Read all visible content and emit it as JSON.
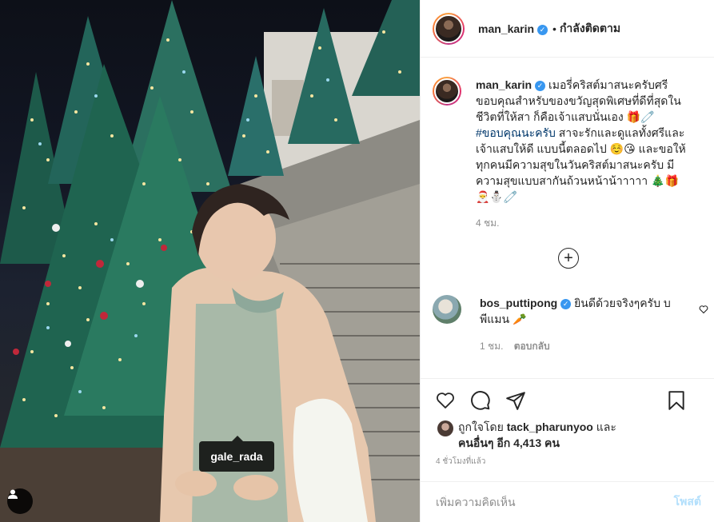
{
  "photo": {
    "tag_label": "gale_rada",
    "user_icon": "user-tags-icon"
  },
  "header": {
    "username": "man_karin",
    "separator": "•",
    "follow_label": "กำลังติดตาม"
  },
  "caption": {
    "username": "man_karin",
    "text_before_tag": "เมอรี่คริสต์มาสนะครับศรี ขอบคุณสำหรับของขวัญสุดพิเศษที่ดีที่สุดในชีวิตที่ให้สา ก็คือเจ้าแสบนั่นเอง 🎁🧷",
    "hashtag": "#ขอบคุณนะครับ",
    "text_after_tag": " สาจะรักและดูแลทั้งศรีและเจ้าแสบให้ดี แบบนี้ตลอดไป ☺️😘 และขอให้ทุกคนมีความสุขในวันคริสต์มาสนะครับ มีความสุขแบบสากันถ้วนหน้าน้าาาาา 🎄🎁🎅⛄🧷",
    "time": "4 ชม."
  },
  "load_more_icon": "plus-circle-icon",
  "comment": {
    "username": "bos_puttipong",
    "text": "ยินดีด้วยจริงๆครับ บพีแมน 🥕",
    "time": "1 ชม.",
    "reply_label": "ตอบกลับ"
  },
  "actions": {
    "like_icon": "heart-icon",
    "comment_icon": "comment-icon",
    "share_icon": "paper-plane-icon",
    "save_icon": "bookmark-icon"
  },
  "likes": {
    "prefix": "ถูกใจโดย ",
    "liker": "tack_pharunyoo",
    "connector": " และ",
    "others": "คนอื่นๆ อีก 4,413 คน"
  },
  "timestamp": "4 ชั่วโมงที่แล้ว",
  "add_comment": {
    "placeholder": "เพิ่มความคิดเห็น",
    "post_label": "โพสต์"
  },
  "colors": {
    "verified": "#3897f0",
    "post_disabled": "#b2dffc",
    "hashtag": "#00376b"
  }
}
